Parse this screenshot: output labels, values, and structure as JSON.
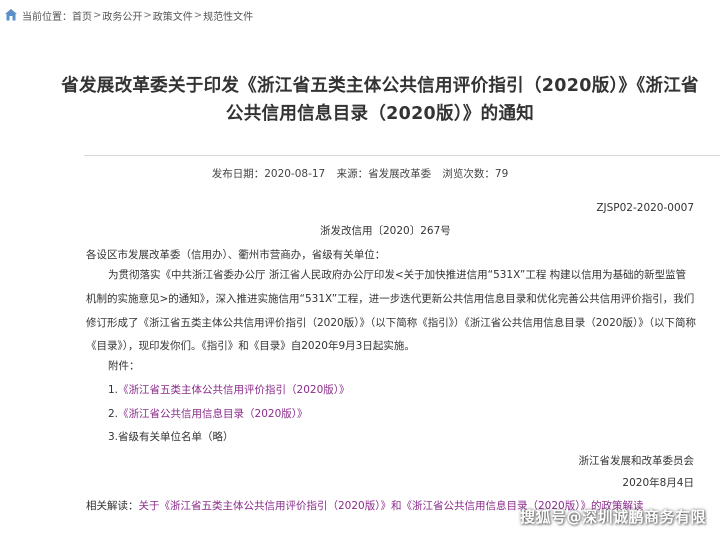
{
  "breadcrumb": {
    "prefix": "当前位置：",
    "items": [
      "首页",
      "政务公开",
      "政策文件",
      "规范性文件"
    ],
    "separator": ">"
  },
  "title": {
    "line1": "省发展改革委关于印发《浙江省五类主体公共信用评价指引（2020版）》《浙江省",
    "line2": "公共信用信息目录（2020版）》的通知"
  },
  "meta": {
    "publish_date": "发布日期：2020-08-17",
    "source": "来源：省发展改革委",
    "views": "浏览次数：79"
  },
  "doc_code": "ZJSP02-2020-0007",
  "file_number": "浙发改信用〔2020〕267号",
  "addressee": "各设区市发展改革委（信用办）、衢州市营商办，省级有关单位：",
  "body": "为贯彻落实《中共浙江省委办公厅 浙江省人民政府办公厅印发<关于加快推进信用“531X”工程 构建以信用为基础的新型监管机制的实施意见>的通知》，深入推进实施信用“531X”工程，进一步迭代更新公共信用信息目录和优化完善公共信用评价指引，我们修订形成了《浙江省五类主体公共信用评价指引（2020版）》（以下简称《指引》）《浙江省公共信用信息目录（2020版）》（以下简称《目录》），现印发你们。《指引》和《目录》自2020年9月3日起实施。",
  "attachments": {
    "label": "附件：",
    "items": [
      {
        "num": "1.",
        "text": "《浙江省五类主体公共信用评价指引（2020版）》"
      },
      {
        "num": "2.",
        "text": "《浙江省公共信用信息目录（2020版）》"
      },
      {
        "num": "3.",
        "text": "省级有关单位名单（略）"
      }
    ]
  },
  "signer": "浙江省发展和改革委员会",
  "sign_date": "2020年8月4日",
  "related": {
    "label": "相关解读：",
    "link": "关于《浙江省五类主体公共信用评价指引（2020版）》和《浙江省公共信用信息目录（2020版）》的政策解读"
  },
  "watermark": {
    "head": "搜狐号",
    "tail": "@深圳诚鹏商务有限"
  },
  "colors": {
    "link": "#8b2c8b",
    "text": "#333333"
  }
}
